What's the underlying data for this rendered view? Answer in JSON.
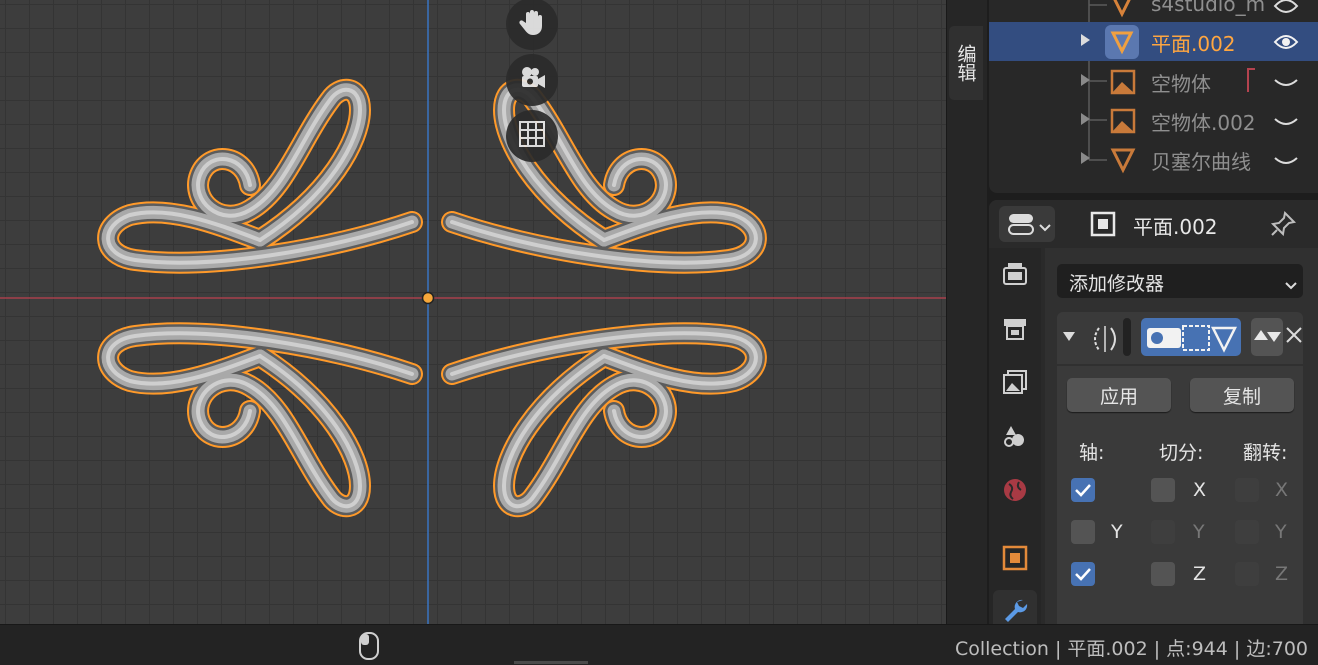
{
  "viewport": {
    "nav": {
      "pan_icon": "hand-icon",
      "camera_icon": "camera-icon",
      "grid_icon": "grid-icon"
    }
  },
  "side_tab": {
    "label": "编辑"
  },
  "outliner": {
    "rows": [
      {
        "label": "s4studio_m",
        "icon": "mesh-icon"
      },
      {
        "label": "平面.002",
        "icon": "mesh-icon",
        "selected": true
      },
      {
        "label": "空物体",
        "icon": "empty-image-icon"
      },
      {
        "label": "空物体.002",
        "icon": "empty-image-icon"
      },
      {
        "label": "贝塞尔曲线",
        "icon": "curve-icon"
      }
    ]
  },
  "properties": {
    "object_name": "平面.002",
    "add_modifier": "添加修改器",
    "apply": "应用",
    "copy": "复制",
    "axis_label": "轴:",
    "bisect_label": "切分:",
    "flip_label": "翻转:",
    "axes": [
      {
        "name": "X",
        "axis": true,
        "bisect": false,
        "flip": false
      },
      {
        "name": "Y",
        "axis": false,
        "bisect": false,
        "flip": false
      },
      {
        "name": "Z",
        "axis": true,
        "bisect": false,
        "flip": false
      }
    ]
  },
  "status": {
    "text": "Collection | 平面.002 | 点:944 | 边:700"
  },
  "colors": {
    "accent": "#4772b3",
    "selection": "#ffa030",
    "axis_x": "#b4434f",
    "axis_y": "#3a74c1"
  }
}
